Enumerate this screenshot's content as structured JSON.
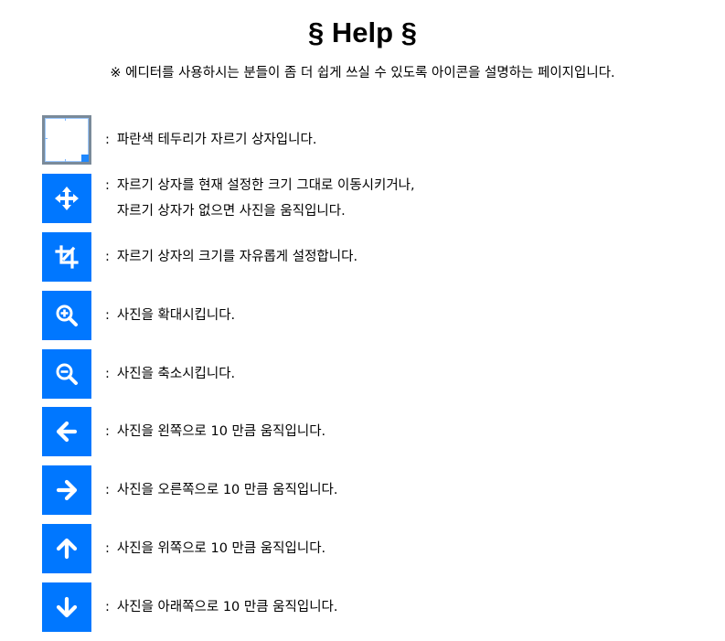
{
  "page": {
    "title": "§ Help §",
    "intro": "※ 에디터를 사용하시는 분들이 좀 더 쉽게 쓰실 수 있도록 아이콘을 설명하는 페이지입니다."
  },
  "items": [
    {
      "icon": "crop-box-sample-icon",
      "colon": ":",
      "lines": [
        "파란색 테두리가 자르기 상자입니다."
      ]
    },
    {
      "icon": "move-icon",
      "colon": ":",
      "lines": [
        "자르기 상자를 현재 설정한 크기 그대로 이동시키거나,",
        "자르기 상자가 없으면 사진을 움직입니다."
      ]
    },
    {
      "icon": "crop-icon",
      "colon": ":",
      "lines": [
        "자르기 상자의 크기를 자유롭게 설정합니다."
      ]
    },
    {
      "icon": "zoom-in-icon",
      "colon": ":",
      "lines": [
        "사진을 확대시킵니다."
      ]
    },
    {
      "icon": "zoom-out-icon",
      "colon": ":",
      "lines": [
        "사진을 축소시킵니다."
      ]
    },
    {
      "icon": "arrow-left-icon",
      "colon": ":",
      "lines": [
        "사진을 왼쪽으로 10 만큼 움직입니다."
      ]
    },
    {
      "icon": "arrow-right-icon",
      "colon": ":",
      "lines": [
        "사진을 오른쪽으로 10 만큼 움직입니다."
      ]
    },
    {
      "icon": "arrow-up-icon",
      "colon": ":",
      "lines": [
        "사진을 위쪽으로 10 만큼 움직입니다."
      ]
    },
    {
      "icon": "arrow-down-icon",
      "colon": ":",
      "lines": [
        "사진을 아래쪽으로 10 만큼 움직입니다."
      ]
    }
  ],
  "colors": {
    "icon_background": "#0077ff",
    "icon_foreground": "#ffffff",
    "crop_box_border": "#7a8a99",
    "crop_box_handle": "#1e88ff"
  }
}
